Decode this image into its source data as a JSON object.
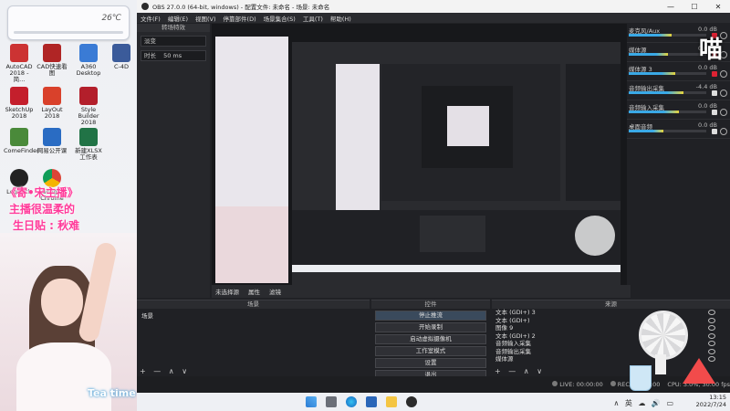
{
  "desktop": {
    "ac_temp": "26℃",
    "icons": [
      {
        "label": "AutoCAD 2018 - 简...",
        "color": "#c33"
      },
      {
        "label": "CAD快速看图",
        "color": "#b02525"
      },
      {
        "label": "A360 Desktop",
        "color": "#3a7bd5"
      },
      {
        "label": "C-4D",
        "color": "#3b5b9a"
      },
      {
        "label": "SketchUp 2018",
        "color": "#c41f2c"
      },
      {
        "label": "LayOut 2018",
        "color": "#d9412b"
      },
      {
        "label": "Style Builder 2018",
        "color": "#b31f2b"
      },
      {
        "label": "ComeFinder",
        "color": "#4a8a3a"
      },
      {
        "label": "网易公开课",
        "color": "#2a6cc3"
      },
      {
        "label": "新建XLSX工作表",
        "color": "#217346"
      },
      {
        "label": "Logitech",
        "color": "#222"
      },
      {
        "label": "Google Chrome",
        "color": "#e8b12c"
      }
    ],
    "captions": [
      "《寄•宋主播》",
      "主播很温柔的",
      "生日贴 :   秋难"
    ]
  },
  "obs": {
    "title": "OBS 27.0.0 (64-bit, windows) - 配置文件: 未命名 - 场景: 未命名",
    "menu": [
      "文件(F)",
      "编辑(E)",
      "视图(V)",
      "停靠部件(D)",
      "场景集合(S)",
      "工具(T)",
      "帮助(H)"
    ],
    "transitions_title": "转场特效",
    "transition_value": "淡变",
    "duration_label": "时长",
    "duration_value": "50 ms",
    "mixer": [
      {
        "name": "麦克风/Aux",
        "db": "0.0 dB",
        "level": 0.55
      },
      {
        "name": "媒体源",
        "db": "0.0 dB",
        "level": 0.5
      },
      {
        "name": "媒体源 3",
        "db": "0.0 dB",
        "level": 0.6
      },
      {
        "name": "音频输出采集",
        "db": "-4.4 dB",
        "level": 0.7
      },
      {
        "name": "音频输入采集",
        "db": "0.0 dB",
        "level": 0.65
      },
      {
        "name": "桌面音频",
        "db": "0.0 dB",
        "level": 0.45
      }
    ],
    "mid_strip": [
      "未选择源",
      "属性",
      "滤镜"
    ],
    "scenes_title": "场景",
    "scenes": [
      "场景"
    ],
    "controls_title": "控件",
    "controls": [
      "停止推流",
      "开始录制",
      "启动虚拟摄像机",
      "工作室模式",
      "设置",
      "退出"
    ],
    "sources_title": "来源",
    "sources": [
      "文本 (GDI+) 3",
      "文本 (GDI+)",
      "图像 9",
      "文本 (GDI+) 2",
      "音频输入采集",
      "音频输出采集",
      "媒体源"
    ],
    "dock_buttons": "+ — ∧ ∨",
    "status": {
      "live": "LIVE: 00:00:00",
      "rec": "REC: 00:00:00",
      "cpu": "CPU: 3.0%, 30.00 fps"
    }
  },
  "overlay_text": {
    "cat": "喵",
    "tea": "Tea time"
  },
  "taskbar": {
    "time": "13:15",
    "date": "2022/7/24",
    "tray": "∧ 英 ☁ 🔊 ▭"
  },
  "colors": {
    "accent": "#3aa9e6",
    "caption": "#ff3a9a",
    "obs_bg": "#202125"
  }
}
